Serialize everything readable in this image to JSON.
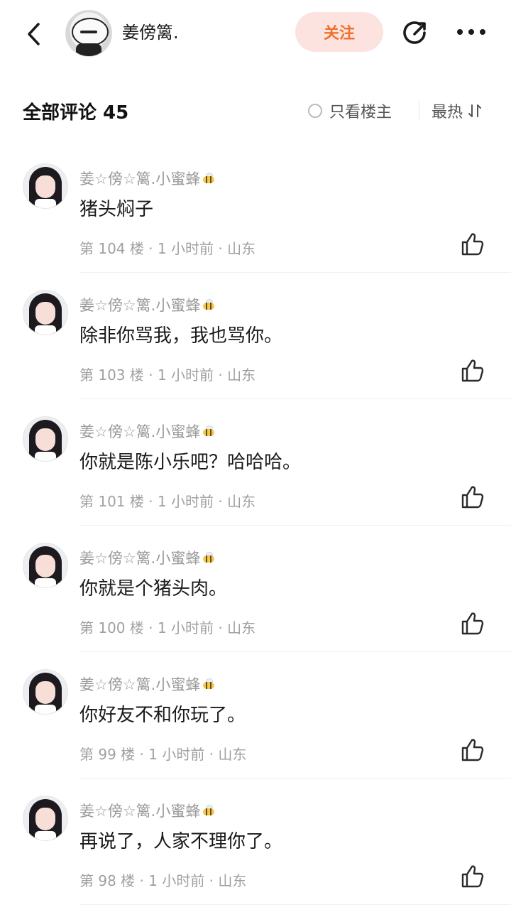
{
  "header": {
    "username": "姜傍篱.",
    "follow_label": "关注"
  },
  "comments_header": {
    "title": "全部评论 45",
    "only_owner_label": "只看楼主",
    "sort_label": "最热"
  },
  "comments": [
    {
      "name": "姜☆傍☆篱.小蜜蜂",
      "text": "猪头焖子",
      "meta": "第 104 楼 · 1 小时前 · 山东"
    },
    {
      "name": "姜☆傍☆篱.小蜜蜂",
      "text": "除非你骂我，我也骂你。",
      "meta": "第 103 楼 · 1 小时前 · 山东"
    },
    {
      "name": "姜☆傍☆篱.小蜜蜂",
      "text": "你就是陈小乐吧？哈哈哈。",
      "meta": "第 101 楼 · 1 小时前 · 山东"
    },
    {
      "name": "姜☆傍☆篱.小蜜蜂",
      "text": "你就是个猪头肉。",
      "meta": "第 100 楼 · 1 小时前 · 山东"
    },
    {
      "name": "姜☆傍☆篱.小蜜蜂",
      "text": "你好友不和你玩了。",
      "meta": "第 99 楼 · 1 小时前 · 山东"
    },
    {
      "name": "姜☆傍☆篱.小蜜蜂",
      "text": "再说了，人家不理你了。",
      "meta": "第 98 楼 · 1 小时前 · 山东"
    }
  ],
  "icons": {
    "back": "chevron-left-icon",
    "share": "share-icon",
    "more": "more-dots-icon",
    "sort": "sort-icon",
    "like": "thumbs-up-icon",
    "badge": "bee-icon"
  },
  "colors": {
    "follow_bg": "#fde3df",
    "follow_text": "#f1702c",
    "meta_text": "#a0a0a0"
  }
}
